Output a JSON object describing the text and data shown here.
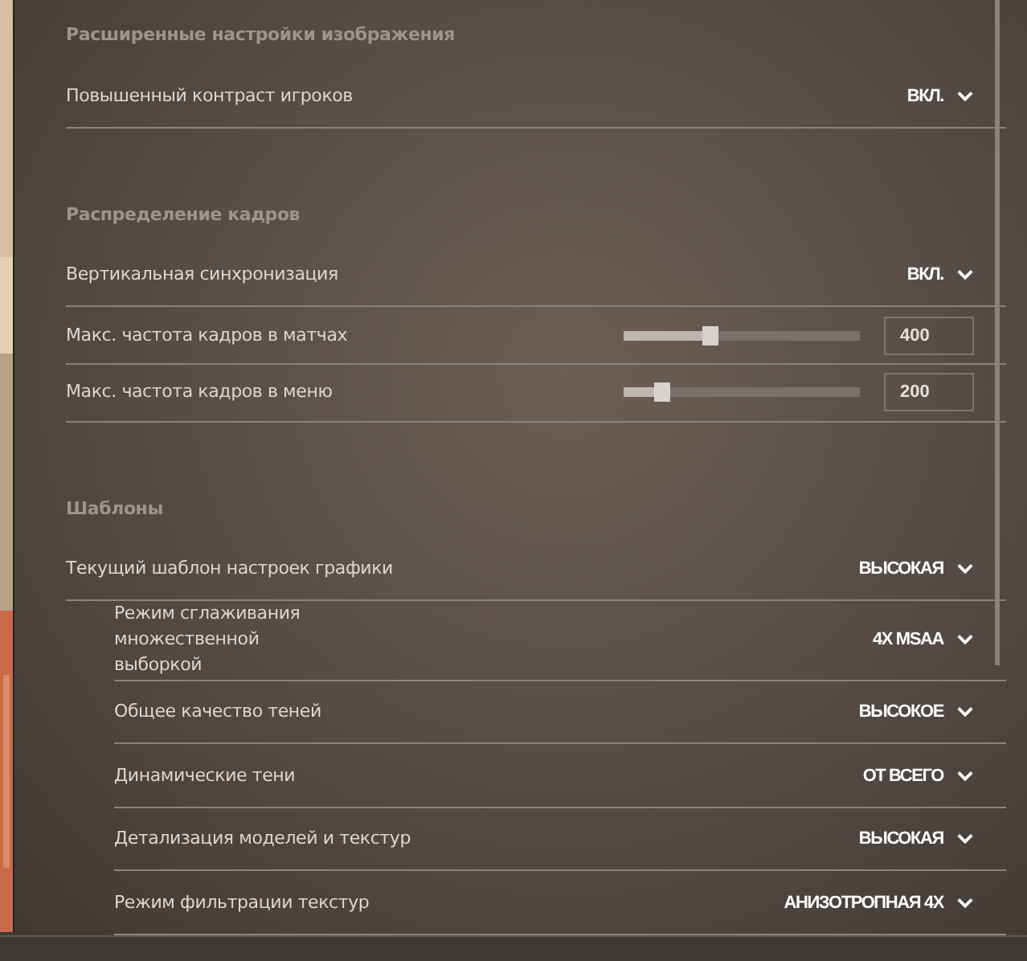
{
  "sections": [
    {
      "heading": "Расширенные настройки изображения",
      "rows": [
        {
          "kind": "dropdown",
          "label": "Повышенный контраст игроков",
          "value": "ВКЛ."
        }
      ]
    },
    {
      "heading": "Распределение кадров",
      "rows": [
        {
          "kind": "dropdown",
          "label": "Вертикальная синхронизация",
          "value": "ВКЛ."
        },
        {
          "kind": "slider",
          "label": "Макс. частота кадров в матчах",
          "level": 0.37,
          "value": "400"
        },
        {
          "kind": "slider",
          "label": "Макс. частота кадров в меню",
          "level": 0.16,
          "value": "200"
        }
      ]
    },
    {
      "heading": "Шаблоны",
      "rows": [
        {
          "kind": "dropdown",
          "label": "Текущий шаблон настроек графики",
          "value": "ВЫСОКАЯ",
          "children": [
            {
              "kind": "dropdown",
              "label": "Режим сглаживания множественной выборкой",
              "value": "4X MSAA"
            },
            {
              "kind": "dropdown",
              "label": "Общее качество теней",
              "value": "ВЫСОКОЕ"
            },
            {
              "kind": "dropdown",
              "label": "Динамические тени",
              "value": "ОТ ВСЕГО"
            },
            {
              "kind": "dropdown",
              "label": "Детализация моделей и текстур",
              "value": "ВЫСОКАЯ"
            },
            {
              "kind": "dropdown",
              "label": "Режим фильтрации текстур",
              "value": "АНИЗОТРОПНАЯ 4X"
            }
          ]
        }
      ]
    }
  ]
}
